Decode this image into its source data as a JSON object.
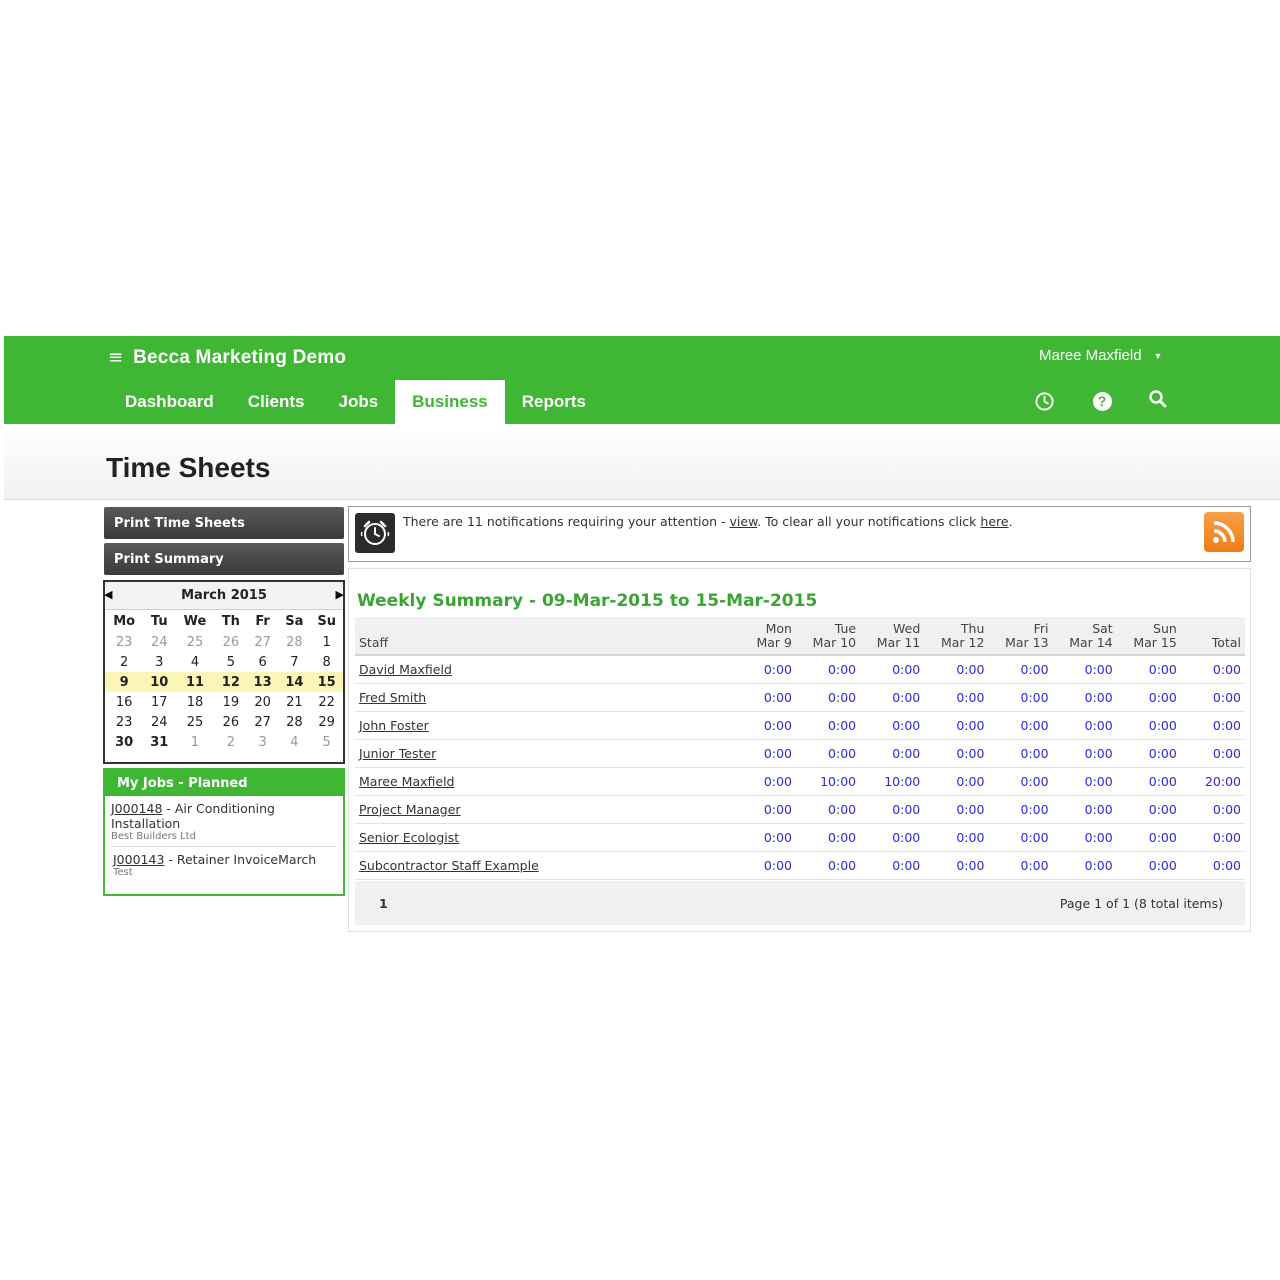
{
  "header": {
    "brand": "Becca Marketing Demo",
    "user_name": "Maree Maxfield",
    "nav_tabs": [
      {
        "label": "Dashboard"
      },
      {
        "label": "Clients"
      },
      {
        "label": "Jobs"
      },
      {
        "label": "Business",
        "active": true
      },
      {
        "label": "Reports"
      }
    ],
    "icons": [
      "clock-icon",
      "help-icon",
      "search-icon"
    ],
    "accent_color": "#3fb634"
  },
  "page": {
    "title": "Time Sheets"
  },
  "sidebar": {
    "print_time_sheets": "Print Time Sheets",
    "print_summary": "Print Summary",
    "calendar": {
      "month_label": "March 2015",
      "weekdays": [
        "Mo",
        "Tu",
        "We",
        "Th",
        "Fr",
        "Sa",
        "Su"
      ],
      "weeks": [
        [
          "23",
          "24",
          "25",
          "26",
          "27",
          "28",
          "1"
        ],
        [
          "2",
          "3",
          "4",
          "5",
          "6",
          "7",
          "8"
        ],
        [
          "9",
          "10",
          "11",
          "12",
          "13",
          "14",
          "15"
        ],
        [
          "16",
          "17",
          "18",
          "19",
          "20",
          "21",
          "22"
        ],
        [
          "23",
          "24",
          "25",
          "26",
          "27",
          "28",
          "29"
        ],
        [
          "30",
          "31",
          "1",
          "2",
          "3",
          "4",
          "5"
        ]
      ],
      "selected_week_index": 2
    },
    "jobs_panel": {
      "title": "My Jobs - Planned",
      "jobs": [
        {
          "code": "J000148",
          "name": " - Air Conditioning Installation",
          "client": "Best Builders Ltd"
        },
        {
          "code": "J000143",
          "name": " - Retainer InvoiceMarch",
          "client": "Test"
        }
      ]
    }
  },
  "notification": {
    "text_before": "There are 11 notifications requiring your attention - ",
    "view_link": "view",
    "text_middle": ". To clear all your notifications click ",
    "here_link": "here",
    "text_after": "."
  },
  "summary": {
    "title": "Weekly Summary - 09-Mar-2015 to 15-Mar-2015",
    "columns": [
      {
        "top": "",
        "bottom": "Staff"
      },
      {
        "top": "Mon",
        "bottom": "Mar 9"
      },
      {
        "top": "Tue",
        "bottom": "Mar 10"
      },
      {
        "top": "Wed",
        "bottom": "Mar 11"
      },
      {
        "top": "Thu",
        "bottom": "Mar 12"
      },
      {
        "top": "Fri",
        "bottom": "Mar 13"
      },
      {
        "top": "Sat",
        "bottom": "Mar 14"
      },
      {
        "top": "Sun",
        "bottom": "Mar 15"
      },
      {
        "top": "",
        "bottom": "Total"
      }
    ],
    "rows": [
      {
        "staff": "David Maxfield",
        "hours": [
          "0:00",
          "0:00",
          "0:00",
          "0:00",
          "0:00",
          "0:00",
          "0:00",
          "0:00"
        ]
      },
      {
        "staff": "Fred Smith",
        "hours": [
          "0:00",
          "0:00",
          "0:00",
          "0:00",
          "0:00",
          "0:00",
          "0:00",
          "0:00"
        ]
      },
      {
        "staff": "John Foster",
        "hours": [
          "0:00",
          "0:00",
          "0:00",
          "0:00",
          "0:00",
          "0:00",
          "0:00",
          "0:00"
        ]
      },
      {
        "staff": "Junior Tester",
        "hours": [
          "0:00",
          "0:00",
          "0:00",
          "0:00",
          "0:00",
          "0:00",
          "0:00",
          "0:00"
        ]
      },
      {
        "staff": "Maree Maxfield",
        "hours": [
          "0:00",
          "10:00",
          "10:00",
          "0:00",
          "0:00",
          "0:00",
          "0:00",
          "20:00"
        ]
      },
      {
        "staff": "Project Manager",
        "hours": [
          "0:00",
          "0:00",
          "0:00",
          "0:00",
          "0:00",
          "0:00",
          "0:00",
          "0:00"
        ]
      },
      {
        "staff": "Senior Ecologist",
        "hours": [
          "0:00",
          "0:00",
          "0:00",
          "0:00",
          "0:00",
          "0:00",
          "0:00",
          "0:00"
        ]
      },
      {
        "staff": "Subcontractor Staff Example",
        "hours": [
          "0:00",
          "0:00",
          "0:00",
          "0:00",
          "0:00",
          "0:00",
          "0:00",
          "0:00"
        ]
      }
    ],
    "pager": {
      "current_page": "1",
      "info": "Page 1 of 1 (8 total items)"
    }
  }
}
